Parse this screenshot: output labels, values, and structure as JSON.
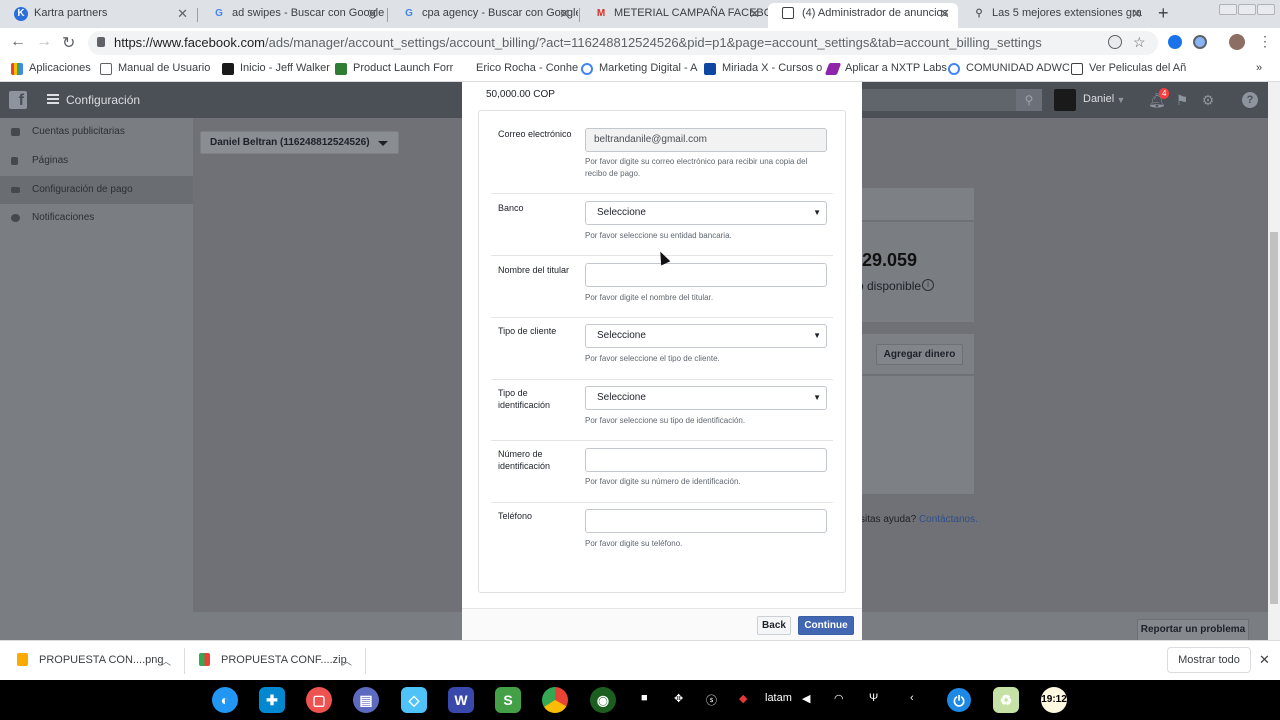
{
  "browser": {
    "tabs": [
      {
        "title": "Kartra partners",
        "active": false
      },
      {
        "title": "ad swipes - Buscar con Google",
        "active": false
      },
      {
        "title": "cpa agency - Buscar con Google",
        "active": false
      },
      {
        "title": "METERIAL CAMPAÑA FACEBOOK",
        "active": false
      },
      {
        "title": "(4) Administrador de anuncios",
        "active": true
      },
      {
        "title": "Las 5 mejores extensiones gra",
        "active": false
      }
    ],
    "url_host": "https://www.facebook.com",
    "url_path": "/ads/manager/account_settings/account_billing/?act=116248812524526&pid=p1&page=account_settings&tab=account_billing_settings",
    "bookmarks": [
      "Aplicaciones",
      "Manual de Usuario",
      "Inicio - Jeff Walker",
      "Product Launch Forr",
      "Erico Rocha - Conhe",
      "Marketing Digital - A",
      "Miriada X - Cursos o",
      "Aplicar a NXTP Labs",
      "COMUNIDAD ADWC",
      "Ver Peliculas del Añ"
    ]
  },
  "fb": {
    "section_title": "Configuración",
    "user_name": "Daniel",
    "notification_count": "4",
    "sidebar": [
      {
        "label": "Cuentas publicitarias",
        "icon": "ad-accounts-icon"
      },
      {
        "label": "Páginas",
        "icon": "pages-icon"
      },
      {
        "label": "Configuración de pago",
        "icon": "payment-settings-icon"
      },
      {
        "label": "Notificaciones",
        "icon": "globe-icon"
      }
    ],
    "account_selector": "Daniel Beltran (116248812524526)",
    "balance_partial": "29.059",
    "available_partial": "o disponible",
    "add_money": "Agregar dinero",
    "help_prefix": "sitas ayuda?",
    "help_link": "Contáctanos.",
    "report_problem": "Reportar un problema"
  },
  "modal": {
    "amount": "50,000.00 COP",
    "fields": [
      {
        "label": "Correo electrónico",
        "type": "text",
        "value": "beltrandanile@gmail.com",
        "hint": "Por favor digite su correo electrónico para recibir una copia del recibo de pago."
      },
      {
        "label": "Banco",
        "type": "select",
        "value": "Seleccione",
        "hint": "Por favor seleccione su entidad bancaria."
      },
      {
        "label": "Nombre del titular",
        "type": "text",
        "value": "",
        "hint": "Por favor digite el nombre del titular."
      },
      {
        "label": "Tipo de cliente",
        "type": "select",
        "value": "Seleccione",
        "hint": "Por favor seleccione el tipo de cliente."
      },
      {
        "label": "Tipo de identificación",
        "type": "select",
        "value": "Seleccione",
        "hint": "Por favor seleccione su tipo de identificación."
      },
      {
        "label": "Número de identificación",
        "type": "text",
        "value": "",
        "hint": "Por favor digite su número de identificación."
      },
      {
        "label": "Teléfono",
        "type": "text",
        "value": "",
        "hint": "Por favor digite su teléfono."
      }
    ],
    "back_label": "Back",
    "continue_label": "Continue"
  },
  "downloads": {
    "items": [
      "PROPUESTA CON....png",
      "PROPUESTA CONF....zip"
    ],
    "show_all": "Mostrar todo"
  },
  "taskbar": {
    "tray_text": "latam",
    "clock_text": "19:12"
  },
  "colors": {
    "fb_blue": "#4267b2",
    "fb_header": "#4b4f56",
    "overlay": "#6f7176"
  }
}
